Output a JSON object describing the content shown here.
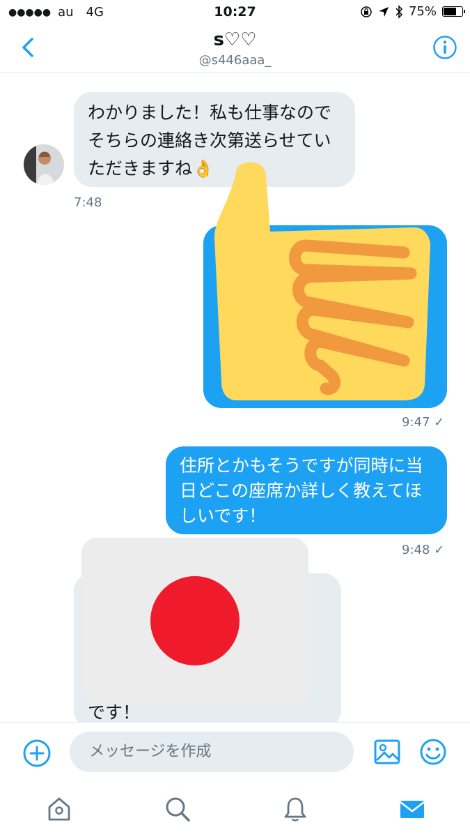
{
  "status_bar": {
    "carrier": "au",
    "network": "4G",
    "time": "10:27",
    "battery": "75%",
    "battery_level": 0.75
  },
  "header": {
    "title": "s♡♡",
    "handle": "@s446aaa_"
  },
  "messages": [
    {
      "direction": "received",
      "text": "わかりました！私も仕事なのでそちらの連絡き次第送らせていただきますね👌",
      "time": "7:48"
    },
    {
      "direction": "sent",
      "text": "",
      "time": "9:47 ✓"
    },
    {
      "direction": "sent",
      "text": "住所とかもそうですが同時に当日どこの座席か詳しく教えてほしいです！",
      "time": "9:48 ✓"
    },
    {
      "direction": "received",
      "text": "です！",
      "time": ""
    }
  ],
  "overlays": {
    "thumb_emoji": "thumbs-up",
    "flag_emoji": "japan-flag"
  },
  "composer": {
    "placeholder": "メッセージを作成"
  },
  "tabs": [
    "home",
    "search",
    "notifications",
    "messages"
  ],
  "colors": {
    "accent": "#1da1f2",
    "received_bubble": "#e6ecf0",
    "muted": "#657786"
  }
}
